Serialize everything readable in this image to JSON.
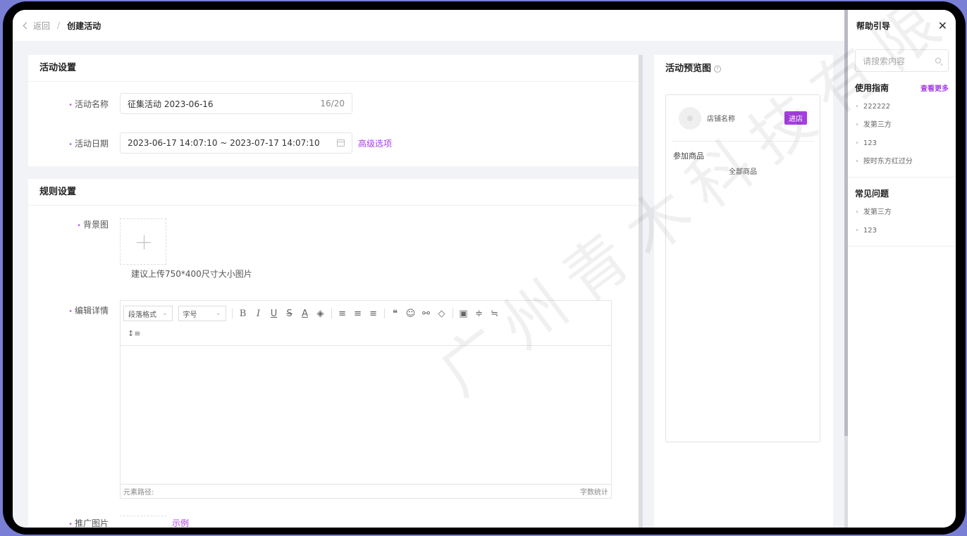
{
  "breadcrumb": {
    "back": "返回",
    "separator": "/",
    "current": "创建活动"
  },
  "activity_settings": {
    "title": "活动设置",
    "name_label": "活动名称",
    "name_value": "征集活动  2023-06-16",
    "name_count": "16/20",
    "date_label": "活动日期",
    "date_value": "2023-06-17 14:07:10 ~ 2023-07-17 14:07:10",
    "advanced_link": "高级选项"
  },
  "rule_settings": {
    "title": "规则设置",
    "bg_label": "背景图",
    "bg_hint": "建议上传750*400尺寸大小图片",
    "detail_label": "编辑详情",
    "paragraph_select": "段落格式",
    "fontsize_select": "字号",
    "element_path": "元素路径:",
    "word_count": "字数统计",
    "promo_label": "推广图片",
    "example_link": "示例"
  },
  "preview": {
    "title": "活动预览图",
    "help_mark": "?",
    "shop_name": "店铺名称",
    "enter_button": "进店",
    "join_label": "参加商品",
    "all_goods": "全部商品"
  },
  "help": {
    "title": "帮助引导",
    "close": "✕",
    "search_placeholder": "请搜索内容",
    "guide_title": "使用指南",
    "guide_more": "查看更多",
    "guide_items": [
      "222222",
      "发第三方",
      "123",
      "按时东方红过分"
    ],
    "faq_title": "常见问题",
    "faq_items": [
      "发第三方",
      "123"
    ]
  },
  "watermark": "广州青木科技有限公",
  "colors": {
    "accent": "#a63ee0",
    "frame": "#000000",
    "background": "#f2f3f6"
  }
}
